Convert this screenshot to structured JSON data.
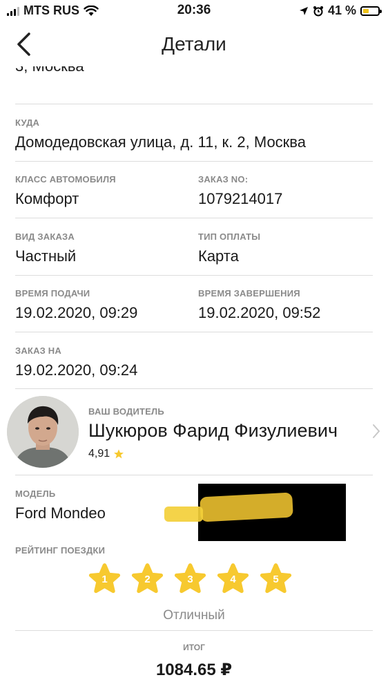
{
  "status_bar": {
    "carrier": "MTS RUS",
    "time": "20:36",
    "battery_percent": "41 %",
    "battery_level": 0.41
  },
  "nav": {
    "title": "Детали"
  },
  "from": {
    "address_tail": "3, Москва"
  },
  "to": {
    "label": "КУДА",
    "value": "Домодедовская улица, д. 11, к. 2, Москва"
  },
  "car_class": {
    "label": "КЛАСС АВТОМОБИЛЯ",
    "value": "Комфорт"
  },
  "order_no": {
    "label": "ЗАКАЗ NO:",
    "value": "1079214017"
  },
  "order_kind": {
    "label": "ВИД ЗАКАЗА",
    "value": "Частный"
  },
  "payment_type": {
    "label": "ТИП ОПЛАТЫ",
    "value": "Карта"
  },
  "pickup_time": {
    "label": "ВРЕМЯ ПОДАЧИ",
    "value": "19.02.2020, 09:29"
  },
  "end_time": {
    "label": "ВРЕМЯ ЗАВЕРШЕНИЯ",
    "value": "19.02.2020, 09:52"
  },
  "ordered_for": {
    "label": "ЗАКАЗ НА",
    "value": "19.02.2020, 09:24"
  },
  "driver": {
    "label": "ВАШ ВОДИТЕЛЬ",
    "name": "Шукюров Фарид Физулиевич",
    "rating": "4,91"
  },
  "car_model": {
    "label": "МОДЕЛЬ",
    "value": "Ford Mondeo"
  },
  "trip_rating": {
    "label": "РЕЙТИНГ ПОЕЗДКИ",
    "stars": [
      "1",
      "2",
      "3",
      "4",
      "5"
    ],
    "word": "Отличный"
  },
  "total": {
    "label": "ИТОГ",
    "value": "1084.65 ₽"
  },
  "colors": {
    "accent": "#f7c92f",
    "label": "#8a8a8a",
    "divider": "#dcdcdc"
  }
}
